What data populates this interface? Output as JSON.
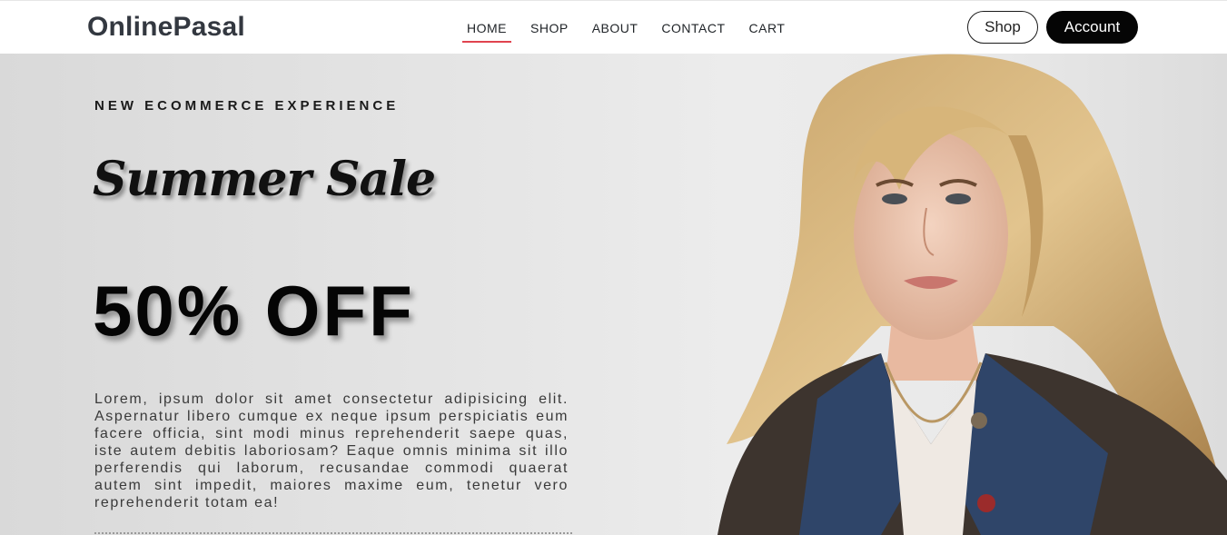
{
  "navbar": {
    "brand": "OnlinePasal",
    "links": [
      {
        "label": "HOME",
        "active": true
      },
      {
        "label": "SHOP",
        "active": false
      },
      {
        "label": "ABOUT",
        "active": false
      },
      {
        "label": "CONTACT",
        "active": false
      },
      {
        "label": "CART",
        "active": false
      }
    ],
    "shop_button": "Shop",
    "account_button": "Account"
  },
  "hero": {
    "eyebrow": "NEW ECOMMERCE EXPERIENCE",
    "script_title": "Summer Sale",
    "discount": "50% OFF",
    "body": "Lorem, ipsum dolor sit amet consectetur adipisicing elit. Aspernatur libero cumque ex neque ipsum perspiciatis eum facere officia, sint modi minus reprehenderit saepe quas, iste autem debitis laboriosam? Eaque omnis minima sit illo perferendis qui laborum, recusandae commodi quaerat autem sint impedit, maiores maxime eum, tenetur vero reprehenderit totam ea!"
  },
  "colors": {
    "accent": "#e0444f",
    "button_dark": "#050505",
    "hero_bg": "#e4e4e4"
  }
}
